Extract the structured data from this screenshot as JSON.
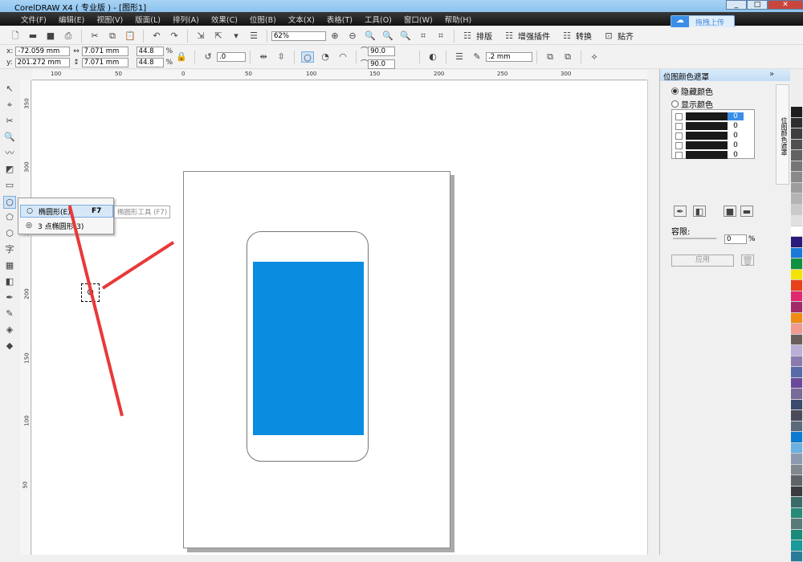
{
  "title": "CorelDRAW X4 ( 专业版 ) - [图形1]",
  "menu": [
    "文件(F)",
    "编辑(E)",
    "视图(V)",
    "版面(L)",
    "排列(A)",
    "效果(C)",
    "位图(B)",
    "文本(X)",
    "表格(T)",
    "工具(O)",
    "窗口(W)",
    "帮助(H)"
  ],
  "upload_label": "拖拽上传",
  "toolbar": {
    "zoom": "62%",
    "plugins": [
      "排版",
      "增强插件",
      "转换",
      "贴齐"
    ]
  },
  "props": {
    "x_label": "x:",
    "y_label": "y:",
    "x": "-72.059 mm",
    "y": "201.272 mm",
    "w": "7.071 mm",
    "h": "7.071 mm",
    "sx": "44.8",
    "sy": "44.8",
    "pct": "%",
    "rotation": ".0",
    "start_angle": "90.0",
    "end_angle": "90.0",
    "outline": ".2 mm"
  },
  "ruler_top": [
    "100",
    "50",
    "0",
    "50",
    "100",
    "150",
    "200",
    "250",
    "300"
  ],
  "ruler_left": [
    "350",
    "300",
    "250",
    "200",
    "150",
    "100",
    "50"
  ],
  "flyout": {
    "items": [
      {
        "label": "椭圆形(E)",
        "shortcut": "F7"
      },
      {
        "label": "3 点椭圆形(3)",
        "shortcut": ""
      }
    ],
    "tooltip": "椭圆形工具 (F7)"
  },
  "docker": {
    "title": "位图颜色遮罩",
    "hide": "隐藏颜色",
    "show": "显示颜色",
    "values": [
      "0",
      "0",
      "0",
      "0",
      "0"
    ],
    "tolerance_label": "容限:",
    "tolerance": "0",
    "pct": "%",
    "apply": "应用",
    "tab_label": "位图颜色遮罩",
    "tab_color": "颜色"
  },
  "palette": [
    "#1e1e1e",
    "#2e2e2e",
    "#3e3e3e",
    "#505050",
    "#626262",
    "#767676",
    "#8a8a8a",
    "#9e9e9e",
    "#b4b4b4",
    "#cacaca",
    "#e0e0e0",
    "#ffffff",
    "#2a1a7a",
    "#1a7ad8",
    "#109040",
    "#f2e400",
    "#e8401a",
    "#e02a70",
    "#a02a6a",
    "#f08a10",
    "#f09a90",
    "#6a5e5a",
    "#b8aed6",
    "#8a7ab0",
    "#5a6aa8",
    "#6a4a9a",
    "#7a6a9a",
    "#3a4a6a",
    "#4a4a5a",
    "#5a6a7a",
    "#0a7ad0",
    "#6ab0e0",
    "#8a9ab0",
    "#808890",
    "#606468",
    "#3a3c40",
    "#3a6a6a",
    "#2a8a7a",
    "#5a7a7a",
    "#1a8a7a",
    "#1a9a9a",
    "#2a7a9a"
  ],
  "colors": {
    "screen": "#0a8ce0",
    "annotation": "#e8393a"
  }
}
